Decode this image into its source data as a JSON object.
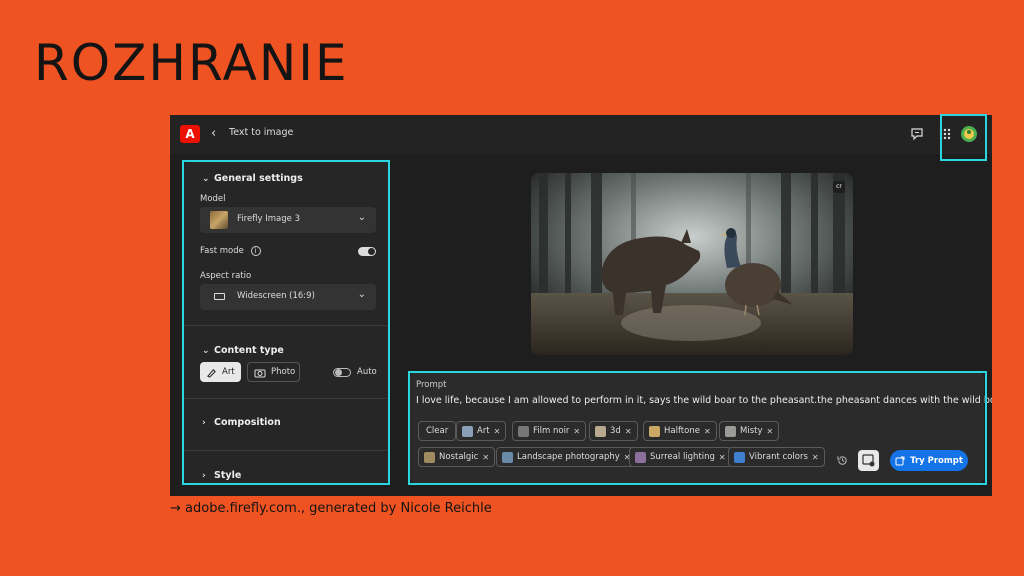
{
  "slide": {
    "title": "ROZHRANIE",
    "caption": "→ adobe.firefly.com., generated by Nicole Reichle"
  },
  "topbar": {
    "page": "Text to image"
  },
  "general_settings": {
    "heading": "General settings",
    "model_label": "Model",
    "model_value": "Firefly Image 3",
    "fast_mode_label": "Fast mode",
    "fast_mode_on": true,
    "aspect_label": "Aspect ratio",
    "aspect_value": "Widescreen (16:9)"
  },
  "content_type": {
    "heading": "Content type",
    "art_label": "Art",
    "photo_label": "Photo",
    "auto_label": "Auto",
    "auto_on": false
  },
  "composition": {
    "heading": "Composition"
  },
  "style": {
    "heading": "Style"
  },
  "prompt": {
    "label": "Prompt",
    "text": "I love life, because I am allowed to perform in it, says the wild boar to the pheasant.the pheasant dances with the wild boar",
    "clear_label": "Clear",
    "chips_row1": [
      "Art",
      "Film noir",
      "3d",
      "Halftone",
      "Misty"
    ],
    "chips_row2": [
      "Nostalgic",
      "Landscape photography",
      "Surreal lighting",
      "Vibrant colors"
    ],
    "try_label": "Try Prompt"
  },
  "colors": {
    "slide_bg": "#F05322",
    "highlight": "#2AD4E0",
    "accent_blue": "#1473E6",
    "adobe_red": "#EB1000"
  }
}
